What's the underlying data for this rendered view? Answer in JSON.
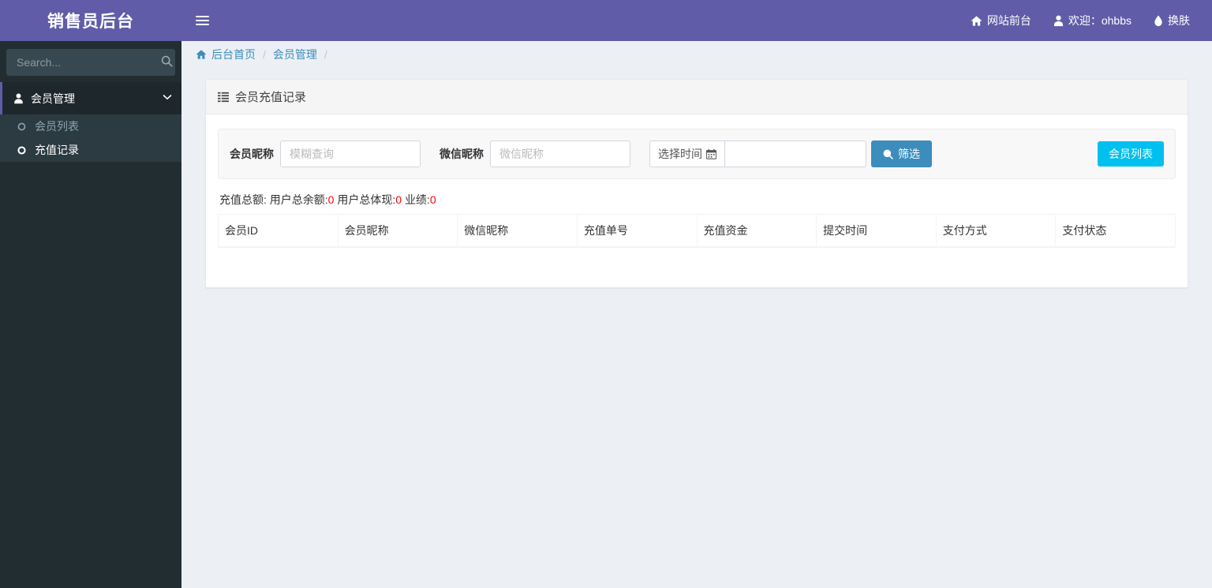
{
  "brand": {
    "title": "销售员后台"
  },
  "navbar": {
    "toggle_icon": "hamburger-icon",
    "items": [
      {
        "id": "site-front",
        "label": "网站前台",
        "icon": "home-icon"
      },
      {
        "id": "welcome",
        "label": "欢迎：ohbbs",
        "icon": "user-icon"
      },
      {
        "id": "change-skin",
        "label": "换肤",
        "icon": "tint-icon"
      }
    ]
  },
  "sidebar": {
    "search": {
      "placeholder": "Search...",
      "value": "",
      "icon": "search-icon"
    },
    "menu": {
      "parent": {
        "label": "会员管理",
        "icon": "user-icon",
        "caret": "chevron-down-icon"
      },
      "items": [
        {
          "id": "member-list",
          "label": "会员列表",
          "icon": "circle-o-icon",
          "active": false
        },
        {
          "id": "recharge-records",
          "label": "充值记录",
          "icon": "circle-o-icon",
          "active": true
        }
      ]
    }
  },
  "breadcrumb": {
    "home_icon": "home-icon",
    "items": [
      "后台首页",
      "会员管理"
    ],
    "separator": "/",
    "trailing_separator": "/"
  },
  "panel": {
    "icon": "list-icon",
    "title": "会员充值记录"
  },
  "filter": {
    "member_nickname": {
      "label": "会员昵称",
      "placeholder": "模糊查询",
      "value": ""
    },
    "wechat_nickname": {
      "label": "微信昵称",
      "placeholder": "微信昵称",
      "value": ""
    },
    "time_select": {
      "label": "选择时间",
      "icon": "calendar-icon",
      "placeholder": "",
      "value": ""
    },
    "submit_button": {
      "label": "筛选",
      "icon": "search-icon"
    },
    "member_list_button": {
      "label": "会员列表"
    }
  },
  "stats": {
    "prefix": "充值总额:",
    "parts": [
      {
        "label": "用户总余额:",
        "value": "0"
      },
      {
        "label": "用户总体现:",
        "value": "0"
      },
      {
        "label": "业绩:",
        "value": "0"
      }
    ]
  },
  "table": {
    "columns": [
      "会员ID",
      "会员昵称",
      "微信昵称",
      "充值单号",
      "充值资金",
      "提交时间",
      "支付方式",
      "支付状态"
    ],
    "rows": []
  },
  "colors": {
    "brand_purple": "#605ca8",
    "sidebar_dark": "#222d32",
    "content_bg": "#ecf0f5",
    "link_blue": "#3c8dbc",
    "accent_cyan": "#00c0ef",
    "stat_red": "#ff0000"
  }
}
